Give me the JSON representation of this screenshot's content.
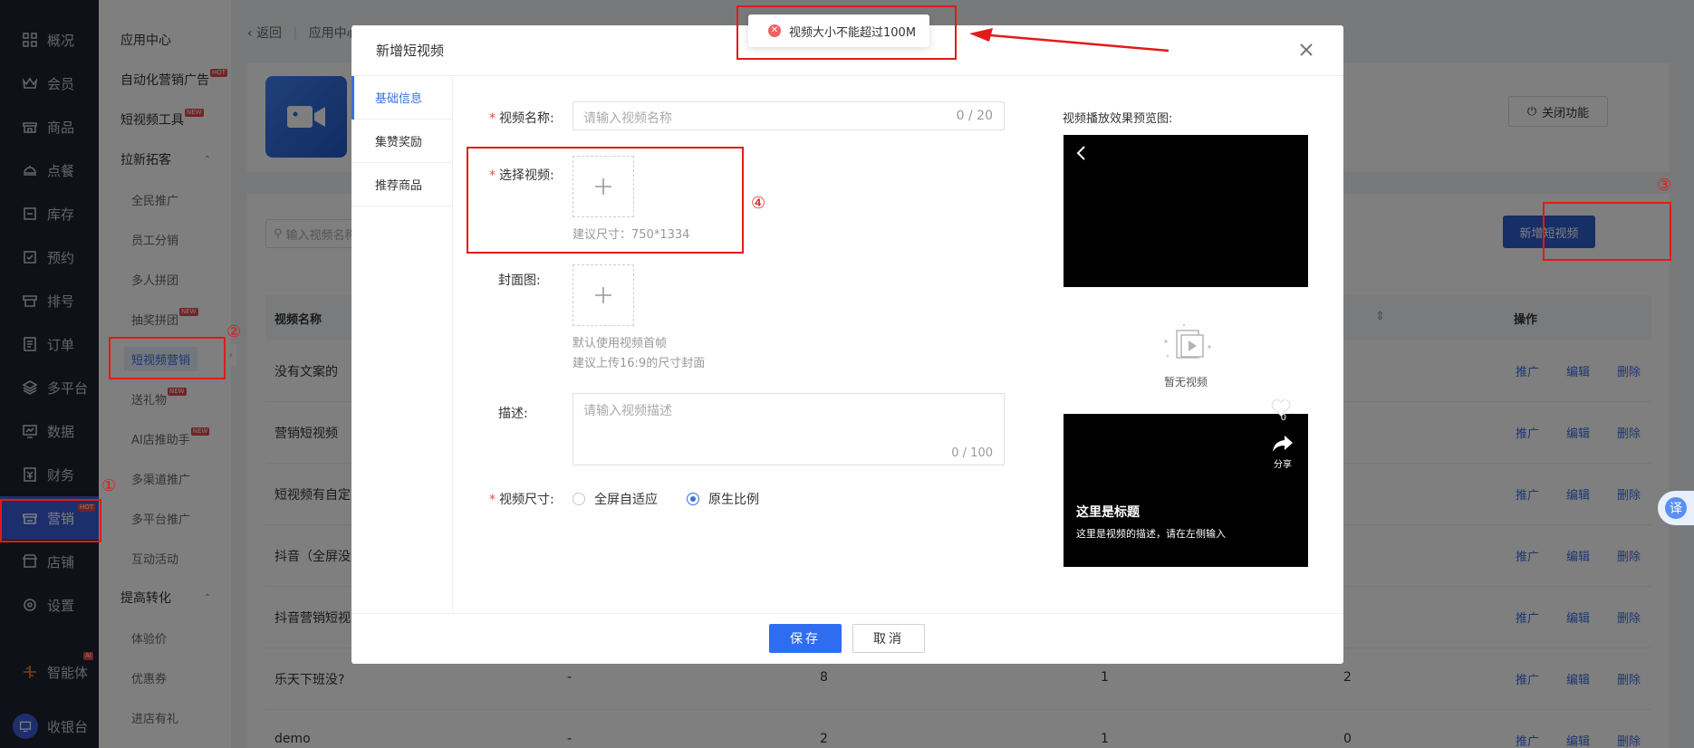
{
  "nav": {
    "items": [
      {
        "label": "概况",
        "icon": "grid-icon"
      },
      {
        "label": "会员",
        "icon": "crown-icon"
      },
      {
        "label": "商品",
        "icon": "store-icon"
      },
      {
        "label": "点餐",
        "icon": "dish-icon"
      },
      {
        "label": "库存",
        "icon": "box-icon"
      },
      {
        "label": "预约",
        "icon": "check-calendar-icon"
      },
      {
        "label": "排号",
        "icon": "ticket-icon"
      },
      {
        "label": "订单",
        "icon": "order-icon"
      },
      {
        "label": "多平台",
        "icon": "layers-icon"
      },
      {
        "label": "数据",
        "icon": "monitor-icon"
      },
      {
        "label": "财务",
        "icon": "finance-icon"
      },
      {
        "label": "营销",
        "icon": "marketing-icon",
        "badge": "HOT",
        "active": true
      },
      {
        "label": "店铺",
        "icon": "shop-icon"
      },
      {
        "label": "设置",
        "icon": "settings-icon"
      }
    ],
    "ai_agent": {
      "label": "智能体",
      "badge": "AI"
    },
    "cashier": {
      "label": "收银台"
    }
  },
  "subnav": {
    "app_center": "应用中心",
    "auto_ads": "自动化营销广告",
    "short_video_tool": "短视频工具",
    "acquire_group": "拉新拓客",
    "acquire_items": [
      "全民推广",
      "员工分销",
      "多人拼团",
      "抽奖拼团",
      "短视频营销",
      "送礼物",
      "AI店推助手",
      "多渠道推广",
      "多平台推广",
      "互动活动"
    ],
    "convert_group": "提高转化",
    "convert_items": [
      "体验价",
      "优惠券",
      "进店有礼"
    ],
    "badges": {
      "hot": "HOT",
      "new": "NEW"
    }
  },
  "main": {
    "back": "返回",
    "crumb_2": "应用中心",
    "close_feature": "关闭功能",
    "search_placeholder": "输入视频名称",
    "add_video": "新增短视频",
    "columns": {
      "name": "视频名称",
      "ops": "操作"
    },
    "rows": [
      {
        "name": "没有文案的",
        "c2": "",
        "c3": "",
        "c4": "",
        "c5": ""
      },
      {
        "name": "营销短视频",
        "c2": "",
        "c3": "",
        "c4": "",
        "c5": ""
      },
      {
        "name": "短视频有自定义",
        "c2": "",
        "c3": "",
        "c4": "",
        "c5": ""
      },
      {
        "name": "抖音（全屏没",
        "c2": "",
        "c3": "",
        "c4": "",
        "c5": ""
      },
      {
        "name": "抖音营销短视",
        "c2": "",
        "c3": "",
        "c4": "",
        "c5": ""
      },
      {
        "name": "乐天下班没?",
        "c2": "-",
        "c3": "8",
        "c4": "1",
        "c5": "2"
      },
      {
        "name": "demo",
        "c2": "-",
        "c3": "2",
        "c4": "1",
        "c5": "0"
      }
    ],
    "ops": {
      "promote": "推广",
      "edit": "编辑",
      "delete": "删除"
    }
  },
  "modal": {
    "title": "新增短视频",
    "tabs": [
      "基础信息",
      "集赞奖励",
      "推荐商品"
    ],
    "video_name_label": "视频名称:",
    "video_name_placeholder": "请输入视频名称",
    "video_name_count": "0 / 20",
    "select_video_label": "选择视频:",
    "video_size_hint": "建议尺寸：750*1334",
    "cover_label": "封面图:",
    "cover_hint_1": "默认使用视频首帧",
    "cover_hint_2": "建议上传16:9的尺寸封面",
    "desc_label": "描述:",
    "desc_placeholder": "请输入视频描述",
    "desc_count": "0 / 100",
    "size_label": "视频尺寸:",
    "size_options": [
      {
        "label": "全屏自适应",
        "checked": false
      },
      {
        "label": "原生比例",
        "checked": true
      }
    ],
    "preview_title": "视频播放效果预览图:",
    "preview": {
      "empty": "暂无视频",
      "likes": "0",
      "share": "分享",
      "title": "这里是标题",
      "desc": "这里是视频的描述，请在左侧输入"
    },
    "save": "保存",
    "cancel": "取消"
  },
  "toast": {
    "message": "视频大小不能超过100M"
  },
  "annotations": [
    "①",
    "②",
    "③",
    "④"
  ],
  "translate_btn": "译",
  "colors": {
    "accent": "#3b6fe0",
    "nav_bg": "#1f2230",
    "annotation": "#e21a1a",
    "primary_btn": "#2f6df0"
  }
}
